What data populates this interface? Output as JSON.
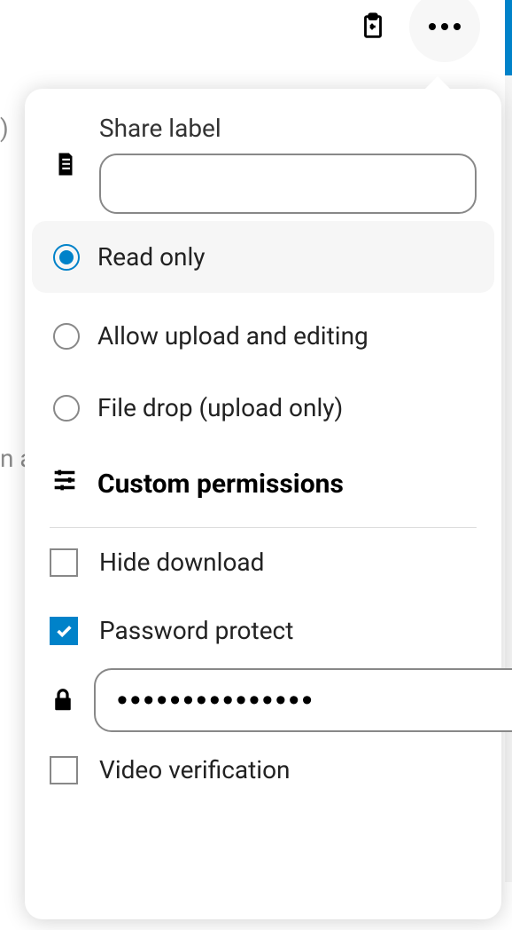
{
  "toolbar": {
    "clipboard_icon": "clipboard-arrow-icon",
    "more_icon": "more-horizontal-icon"
  },
  "share": {
    "label_title": "Share label",
    "label_value": "",
    "options": {
      "read_only": "Read only",
      "allow_upload": "Allow upload and editing",
      "file_drop": "File drop (upload only)"
    },
    "selected_option": "read_only",
    "custom_permissions": "Custom permissions",
    "hide_download": {
      "label": "Hide download",
      "checked": false
    },
    "password_protect": {
      "label": "Password protect",
      "checked": true
    },
    "password_value": "•••••••••••••••",
    "video_verification": {
      "label": "Video verification",
      "checked": false
    }
  },
  "bg": {
    "frag1": ")",
    "frag2": "n a"
  }
}
